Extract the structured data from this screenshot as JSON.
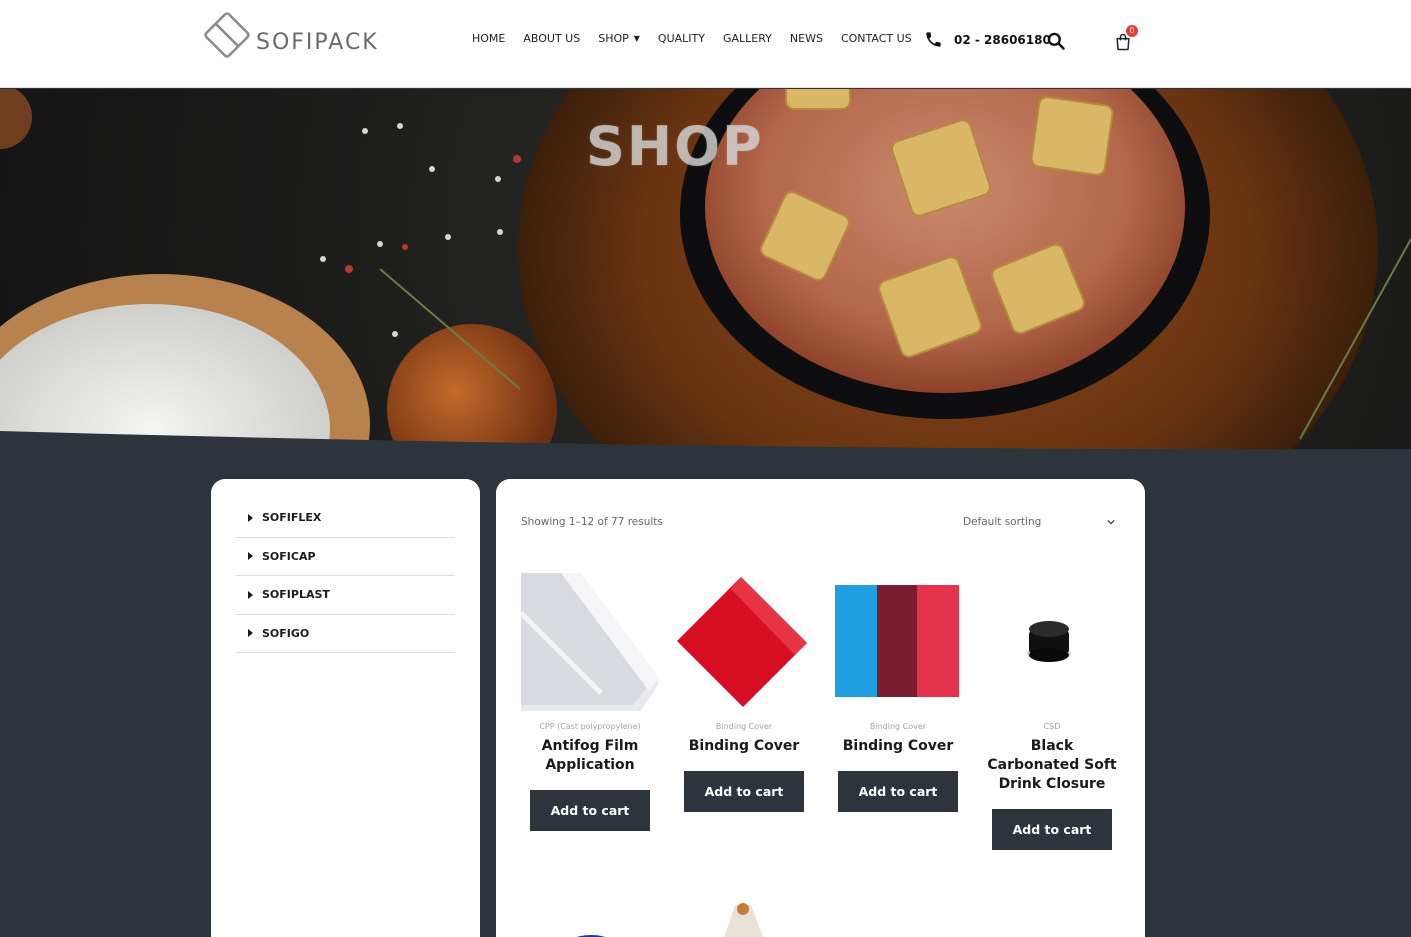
{
  "brand": {
    "name": "SOFIPACK"
  },
  "nav": {
    "items": [
      {
        "label": "HOME"
      },
      {
        "label": "ABOUT US"
      },
      {
        "label": "SHOP",
        "has_dropdown": true
      },
      {
        "label": "QUALITY"
      },
      {
        "label": "GALLERY"
      },
      {
        "label": "NEWS"
      },
      {
        "label": "CONTACT US"
      }
    ],
    "phone": "02 - 28606180",
    "cart_count": "0"
  },
  "hero": {
    "title": "SHOP"
  },
  "sidebar": {
    "categories": [
      {
        "label": "SOFIFLEX"
      },
      {
        "label": "SOFICAP"
      },
      {
        "label": "SOFIPLAST"
      },
      {
        "label": "SOFIGO"
      }
    ]
  },
  "shop": {
    "result_count": "Showing 1–12 of 77 results",
    "sorting": "Default sorting",
    "products": [
      {
        "category": "CPP (Cast polypropylene)",
        "name": "Antifog Film Application",
        "button": "Add to cart",
        "image": "clear-film-roll"
      },
      {
        "category": "Binding Cover",
        "name": "Binding Cover",
        "button": "Add to cart",
        "image": "red-binding-sheet"
      },
      {
        "category": "Binding Cover",
        "name": "Binding Cover",
        "button": "Add to cart",
        "image": "blue-red-binding-sheets"
      },
      {
        "category": "CSD",
        "name": "Black Carbonated Soft Drink Closure",
        "button": "Add to cart",
        "image": "black-bottle-cap"
      }
    ]
  },
  "colors": {
    "dark": "#2d343b",
    "badge": "#e53a35"
  }
}
